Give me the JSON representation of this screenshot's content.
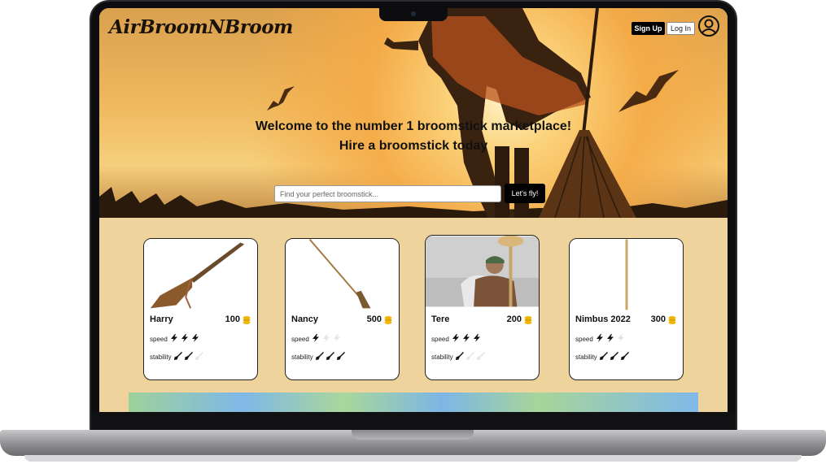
{
  "header": {
    "logo": "AirBroomNBroom",
    "signup_label": "Sign Up",
    "login_label": "Log In"
  },
  "hero": {
    "title_line1": "Welcome to the number 1 broomstick marketplace!",
    "title_line2": "Hire a broomstick today"
  },
  "search": {
    "placeholder": "Find your perfect broomstick...",
    "button_label": "Let's fly!"
  },
  "cards": [
    {
      "name": "Harry",
      "price": "100",
      "speed_label": "speed",
      "speed": 3,
      "stability_label": "stability",
      "stability": 2
    },
    {
      "name": "Nancy",
      "price": "500",
      "speed_label": "speed",
      "speed": 1,
      "stability_label": "stability",
      "stability": 3
    },
    {
      "name": "Tere",
      "price": "200",
      "speed_label": "speed",
      "speed": 3,
      "stability_label": "stability",
      "stability": 1
    },
    {
      "name": "Nimbus 2022",
      "price": "300",
      "speed_label": "speed",
      "speed": 2,
      "stability_label": "stability",
      "stability": 3
    }
  ],
  "colors": {
    "page_background": "#efd39c",
    "button_dark": "#000000",
    "coin": "#f2b705"
  },
  "icons": [
    "user-icon",
    "coin-icon",
    "lightning-icon",
    "broom-icon"
  ]
}
